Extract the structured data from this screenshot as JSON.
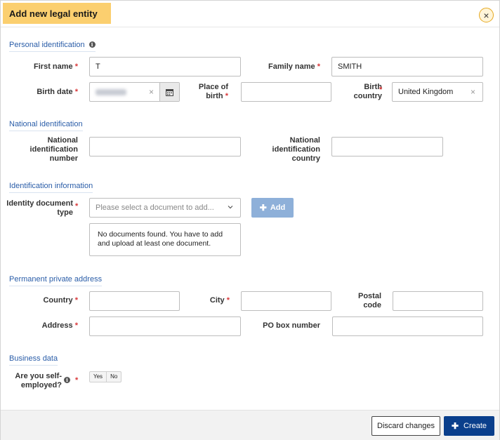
{
  "dialog": {
    "title": "Add new legal entity",
    "close_icon": "close-icon"
  },
  "sections": {
    "personal": "Personal identification",
    "national": "National identification",
    "identification": "Identification information",
    "address": "Permanent private address",
    "business": "Business data"
  },
  "required_mark": "*",
  "info_glyph": "i",
  "personal": {
    "first_name_label": "First name",
    "first_name_value": "T",
    "family_name_label": "Family name",
    "family_name_value": "SMITH",
    "birth_date_label": "Birth date",
    "place_of_birth_label_1": "Place of",
    "place_of_birth_label_2": "birth",
    "birth_country_label_1": "Birth",
    "birth_country_label_2": "country",
    "birth_country_value": "United Kingdom"
  },
  "national": {
    "number_label_1": "National",
    "number_label_2": "identification",
    "number_label_3": "number",
    "country_label_1": "National",
    "country_label_2": "identification",
    "country_label_3": "country"
  },
  "identification": {
    "doc_type_label_1": "Identity document",
    "doc_type_label_2": "type",
    "doc_type_placeholder": "Please select a document to add...",
    "add_label": "Add",
    "no_docs_message": "No documents found. You have to add and upload at least one document."
  },
  "address": {
    "country_label": "Country",
    "city_label": "City",
    "postal_label_1": "Postal",
    "postal_label_2": "code",
    "address_label": "Address",
    "po_box_label": "PO box number"
  },
  "business": {
    "self_employed_label_1": "Are you self-",
    "self_employed_label_2": "employed?",
    "yes_label": "Yes",
    "no_label": "No"
  },
  "footer": {
    "discard_label": "Discard changes",
    "create_label": "Create"
  },
  "colors": {
    "title_highlight": "#fbcf6f",
    "section_link": "#2a5da8",
    "required": "#d9383a",
    "primary_button": "#0a3f8c",
    "add_button": "#8eb0d9"
  }
}
